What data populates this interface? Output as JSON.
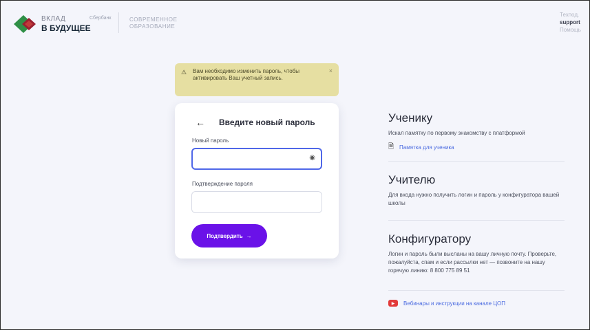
{
  "header": {
    "logo_line1": "ВКЛАД",
    "logo_line2": "В БУДУЩЕЕ",
    "logo_tag": "Сбербанк",
    "brand_line1": "СОВРЕМЕННОЕ",
    "brand_line2": "ОБРАЗОВАНИЕ",
    "user_top": "Техпод.",
    "user_name": "support",
    "user_bottom": "Помощь"
  },
  "alert": {
    "text": "Вам необходимо изменить пароль, чтобы активировать Ваш учетный запись.",
    "warn_icon": "⚠",
    "close_icon": "×"
  },
  "form": {
    "back_icon": "←",
    "title": "Введите новый пароль",
    "new_password_label": "Новый пароль",
    "new_password_value": "",
    "confirm_label": "Подтверждение пароля",
    "confirm_value": "",
    "eye_icon": "◉",
    "submit_label": "Подтвердить",
    "submit_arrow": "→"
  },
  "sections": {
    "student": {
      "title": "Ученику",
      "text": "Искал памятку по первому знакомству с платформой",
      "link": "Памятка для ученика"
    },
    "teacher": {
      "title": "Учителю",
      "text": "Для входа нужно получить логин и пароль у конфигуратора вашей школы"
    },
    "configurator": {
      "title": "Конфигуратору",
      "text": "Логин и пароль были высланы на вашу личную почту. Проверьте, пожалуйста, спам и если рассылки нет — позвоните на нашу горячую линию: 8 800 775 89 51",
      "link": "Вебинары и инструкции на канале ЦОП"
    }
  },
  "colors": {
    "accent": "#6a12e8",
    "alert_bg": "#e6dfa2",
    "link": "#4b6be0",
    "focus": "#4f67e8"
  }
}
